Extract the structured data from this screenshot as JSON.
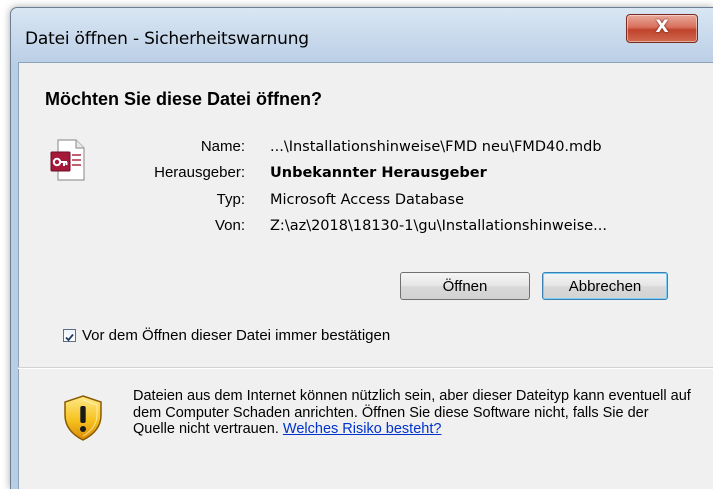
{
  "window": {
    "title": "Datei öffnen - Sicherheitswarnung",
    "close_label": "X"
  },
  "dialog": {
    "heading": "Möchten Sie diese Datei öffnen?",
    "file_icon": "access-database-file-icon",
    "details": [
      {
        "label": "Name:",
        "value": "...\\Installationshinweise\\FMD neu\\FMD40.mdb",
        "bold": false
      },
      {
        "label": "Herausgeber:",
        "value": "Unbekannter Herausgeber",
        "bold": true
      },
      {
        "label": "Typ:",
        "value": "Microsoft Access Database",
        "bold": false
      },
      {
        "label": "Von:",
        "value": "Z:\\az\\2018\\18130-1\\gu\\Installationshinweise...",
        "bold": false
      }
    ],
    "buttons": {
      "open_label": "Öffnen",
      "cancel_label": "Abbrechen"
    },
    "checkbox": {
      "label": "Vor dem Öffnen dieser Datei immer bestätigen",
      "checked": true
    },
    "warning": {
      "icon": "security-shield-warning-icon",
      "text": "Dateien aus dem Internet können nützlich sein, aber dieser Dateityp kann eventuell auf dem Computer Schaden anrichten. Öffnen Sie diese Software nicht, falls Sie der Quelle nicht vertrauen. ",
      "link_text": "Welches Risiko besteht?"
    }
  },
  "colors": {
    "title_bar": "#c3d5ea",
    "close_button": "#c0432c",
    "client_bg": "#f0f0f0",
    "link": "#0033cc"
  }
}
